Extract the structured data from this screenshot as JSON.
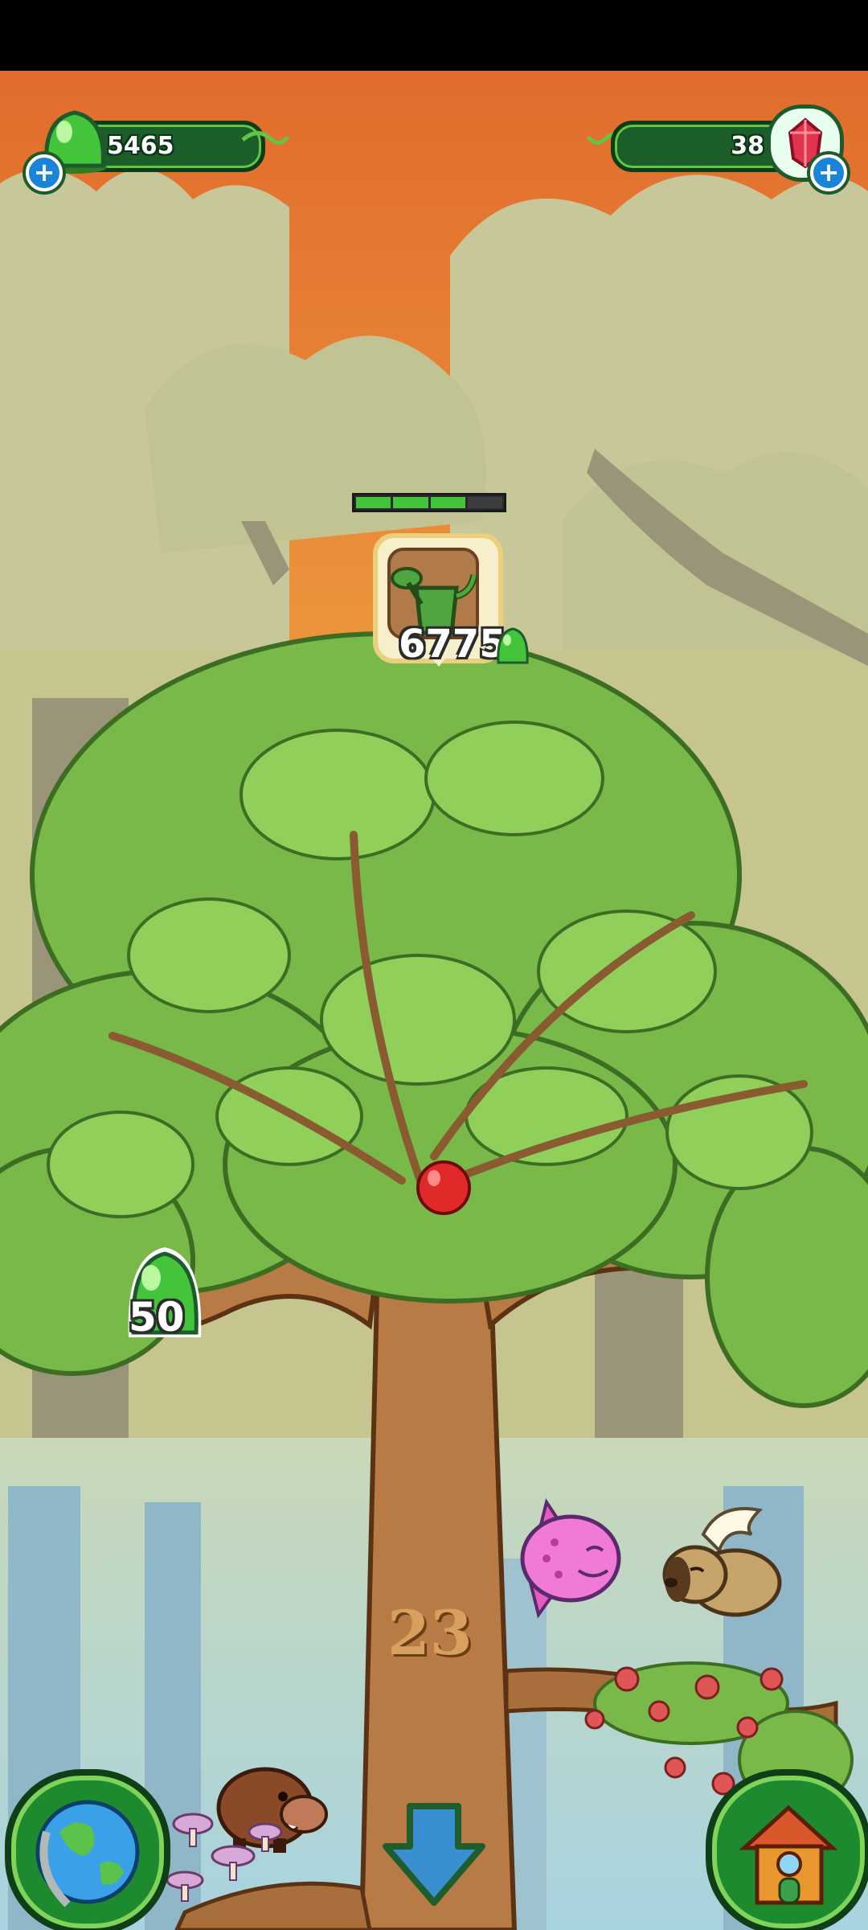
{
  "hud": {
    "currency_gems": "5465",
    "currency_crystals": "38",
    "plus_label": "+"
  },
  "task": {
    "cost": "6775",
    "progress": 0.75,
    "segments": 4
  },
  "tree": {
    "level": "23"
  },
  "pickup": {
    "amount": "50"
  },
  "colors": {
    "accent_green": "#43c43a",
    "hud_dark": "#1b5e2a",
    "sky_orange": "#e07a32"
  }
}
